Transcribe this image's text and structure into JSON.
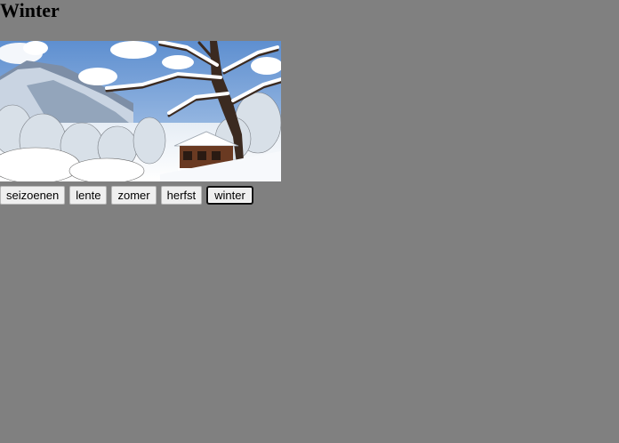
{
  "page": {
    "title": "Winter",
    "background_color": "#808080"
  },
  "photo": {
    "subject": "snowy-winter-landscape-with-cabin"
  },
  "season_buttons": [
    {
      "label": "seizoenen",
      "active": false
    },
    {
      "label": "lente",
      "active": false
    },
    {
      "label": "zomer",
      "active": false
    },
    {
      "label": "herfst",
      "active": false
    },
    {
      "label": "winter",
      "active": true
    }
  ]
}
